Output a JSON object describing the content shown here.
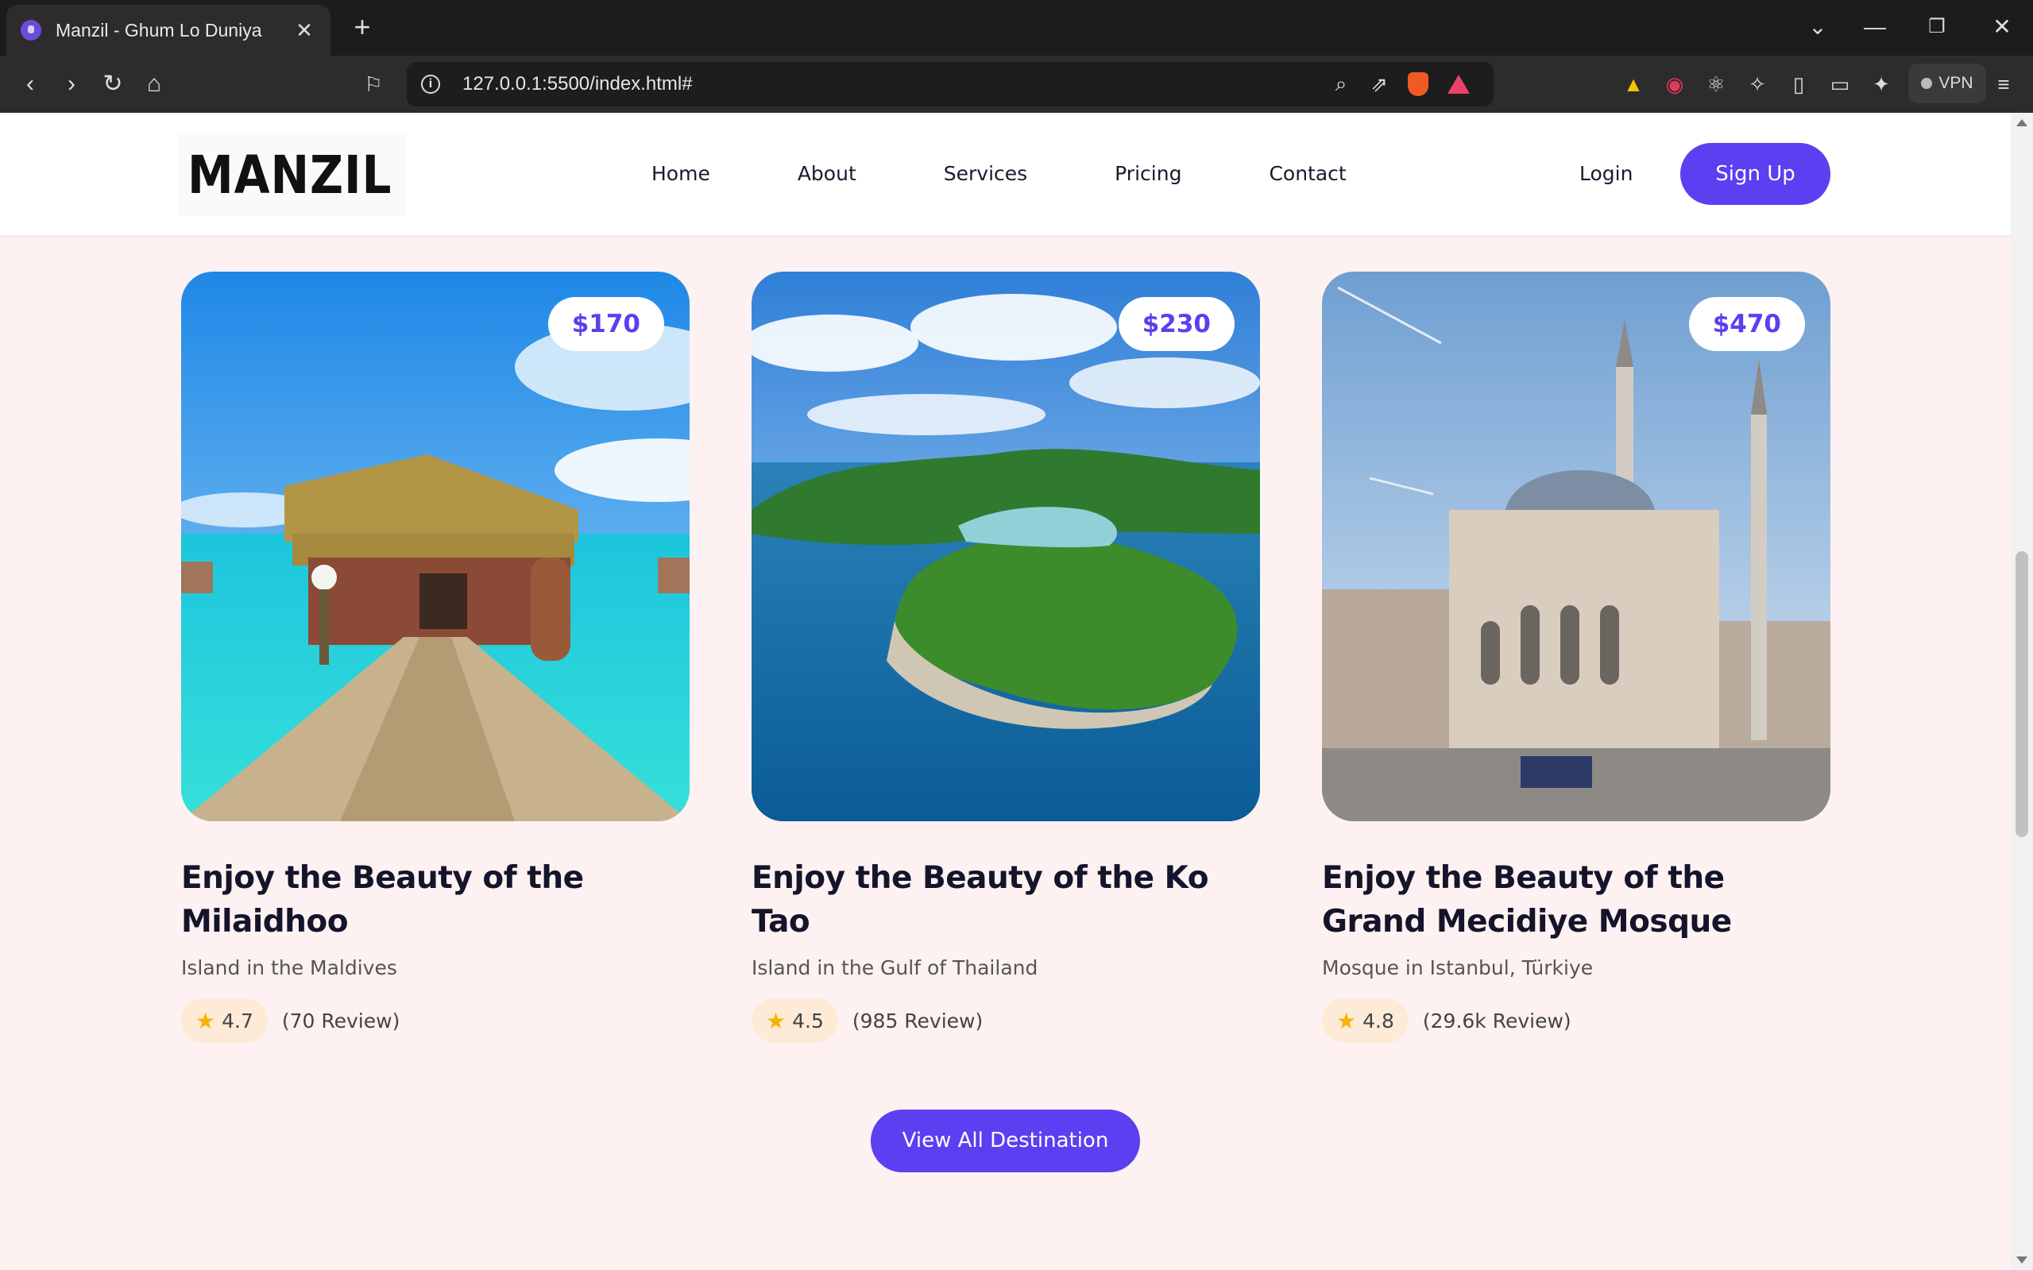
{
  "browser": {
    "tab_title": "Manzil - Ghum Lo Duniya",
    "url": "127.0.0.1:5500/index.html#",
    "vpn_label": "VPN"
  },
  "site": {
    "logo_text": "MANZIL",
    "nav": [
      "Home",
      "About",
      "Services",
      "Pricing",
      "Contact"
    ],
    "login": "Login",
    "signup": "Sign Up",
    "accent_color": "#5b3ff0"
  },
  "cards": [
    {
      "price": "$170",
      "title": "Enjoy the Beauty of the Milaidhoo",
      "subtitle": "Island in the Maldives",
      "rating": "4.7",
      "reviews": "(70 Review)"
    },
    {
      "price": "$230",
      "title": "Enjoy the Beauty of the Ko Tao",
      "subtitle": "Island in the Gulf of Thailand",
      "rating": "4.5",
      "reviews": "(985 Review)"
    },
    {
      "price": "$470",
      "title": "Enjoy the Beauty of the Grand Mecidiye Mosque",
      "subtitle": "Mosque in Istanbul, Türkiye",
      "rating": "4.8",
      "reviews": "(29.6k Review)"
    }
  ],
  "view_all": "View All Destination"
}
